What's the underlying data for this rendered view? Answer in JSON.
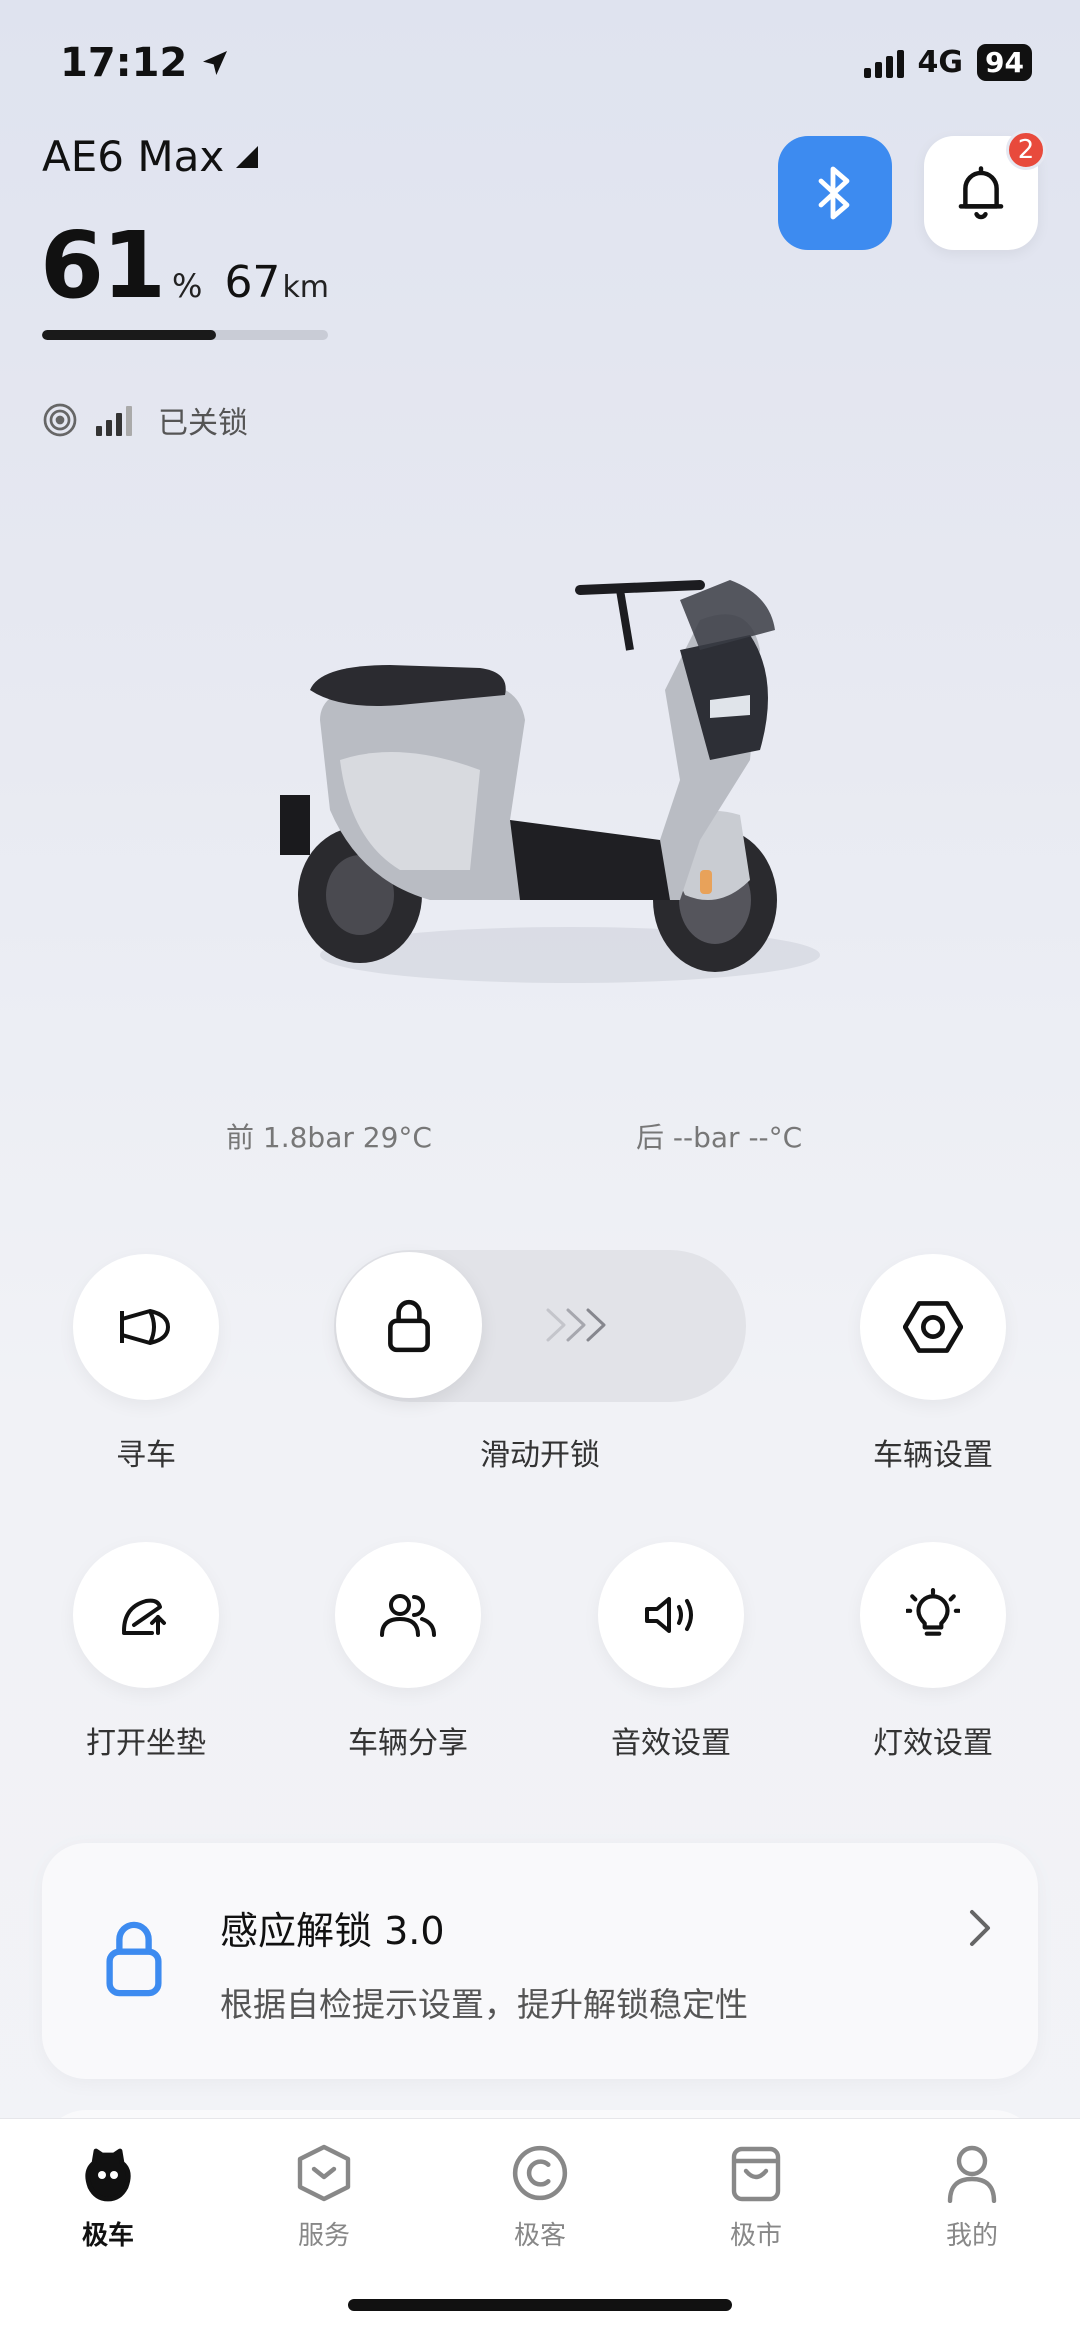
{
  "status_bar": {
    "time": "17:12",
    "network": "4G",
    "battery": "94"
  },
  "vehicle": {
    "model": "AE6 Max",
    "battery_percent": "61",
    "battery_unit": "%",
    "battery_level": 0.61,
    "range": "67",
    "range_unit": "km",
    "lock_status": "已关锁"
  },
  "notifications": {
    "badge_count": "2"
  },
  "tire_pressure": {
    "front": "前 1.8bar 29°C",
    "rear": "后 --bar --°C"
  },
  "actions": {
    "find_car": "寻车",
    "slide_unlock": "滑动开锁",
    "vehicle_settings": "车辆设置",
    "open_seat": "打开坐垫",
    "share_vehicle": "车辆分享",
    "sound_settings": "音效设置",
    "light_settings": "灯效设置"
  },
  "feature_card": {
    "title": "感应解锁 3.0",
    "subtitle": "根据自检提示设置，提升解锁稳定性"
  },
  "bottom_nav": {
    "items": [
      {
        "label": "极车",
        "icon": "scooter-mascot-icon",
        "active": true
      },
      {
        "label": "服务",
        "icon": "service-box-icon",
        "active": false
      },
      {
        "label": "极客",
        "icon": "copyright-circle-icon",
        "active": false
      },
      {
        "label": "极市",
        "icon": "shopping-bag-icon",
        "active": false
      },
      {
        "label": "我的",
        "icon": "person-icon",
        "active": false
      }
    ]
  },
  "colors": {
    "accent_blue": "#3d8bf0",
    "badge_red": "#e84a3c",
    "lock_icon_blue": "#3d8bf0"
  }
}
